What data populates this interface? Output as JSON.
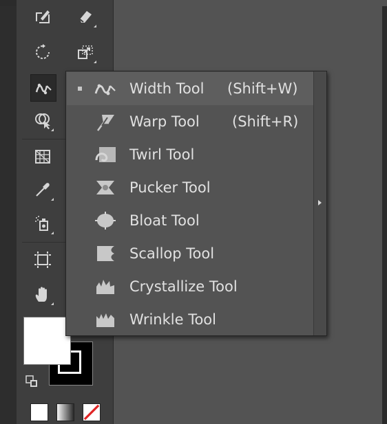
{
  "toolbar": {
    "tools": [
      {
        "name": "shaper-tool",
        "icon": "shaper-icon"
      },
      {
        "name": "eraser-tool",
        "icon": "eraser-icon"
      },
      {
        "name": "rotate-tool",
        "icon": "rotate-icon"
      },
      {
        "name": "scale-tool",
        "icon": "scale-icon"
      },
      {
        "name": "width-tool",
        "icon": "width-icon",
        "active": true
      },
      {
        "name": "free-transform-tool",
        "icon": "free-transform-icon"
      },
      {
        "name": "shape-builder-tool",
        "icon": "shape-builder-icon"
      },
      {
        "name": "eyedropper-tool",
        "icon": "eyedropper-icon"
      },
      {
        "name": "symbol-sprayer-tool",
        "icon": "symbol-sprayer-icon"
      },
      {
        "name": "artboard-tool",
        "icon": "artboard-icon"
      },
      {
        "name": "hand-tool",
        "icon": "hand-icon"
      }
    ],
    "fill_color": "#ffffff",
    "stroke_color": "#000000"
  },
  "flyout": {
    "items": [
      {
        "label": "Width Tool",
        "shortcut": "(Shift+W)",
        "icon": "width-icon",
        "selected": true
      },
      {
        "label": "Warp Tool",
        "shortcut": "(Shift+R)",
        "icon": "warp-icon",
        "selected": false
      },
      {
        "label": "Twirl Tool",
        "shortcut": "",
        "icon": "twirl-icon",
        "selected": false
      },
      {
        "label": "Pucker Tool",
        "shortcut": "",
        "icon": "pucker-icon",
        "selected": false
      },
      {
        "label": "Bloat Tool",
        "shortcut": "",
        "icon": "bloat-icon",
        "selected": false
      },
      {
        "label": "Scallop Tool",
        "shortcut": "",
        "icon": "scallop-icon",
        "selected": false
      },
      {
        "label": "Crystallize Tool",
        "shortcut": "",
        "icon": "crystallize-icon",
        "selected": false
      },
      {
        "label": "Wrinkle Tool",
        "shortcut": "",
        "icon": "wrinkle-icon",
        "selected": false
      }
    ]
  },
  "colors": {
    "panel": "#3e3e3e",
    "canvas": "#535353",
    "menu_bg": "#535353",
    "menu_selected": "#5e5e5e",
    "menu_text": "#e1e1e1"
  }
}
